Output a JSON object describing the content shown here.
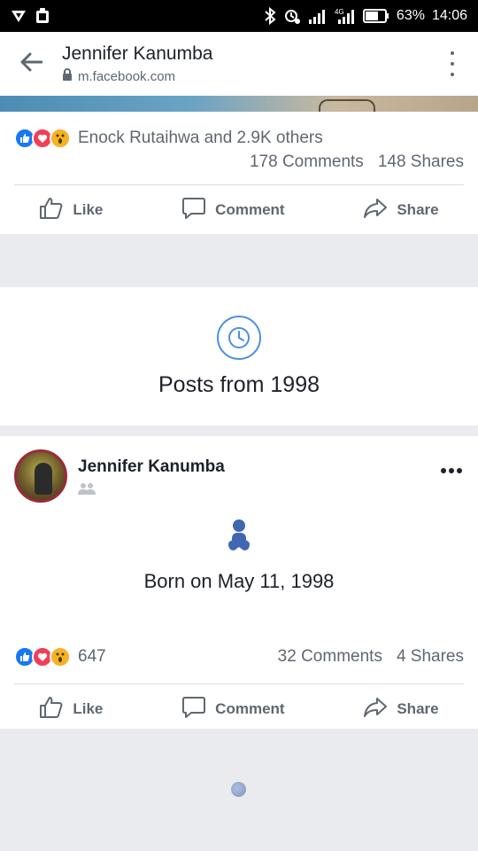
{
  "status_bar": {
    "battery": "63%",
    "time": "14:06",
    "icons": [
      "vpn-icon",
      "notification-icon",
      "bluetooth-icon",
      "alarm-icon",
      "signal-icon",
      "data-icon",
      "battery-icon"
    ]
  },
  "app_bar": {
    "title": "Jennifer Kanumba",
    "url": "m.facebook.com",
    "icons": [
      "back-arrow-icon",
      "lock-icon",
      "more-vertical-icon"
    ]
  },
  "top_post": {
    "reactions_text": "Enock Rutaihwa and 2.9K others",
    "comments": "178 Comments",
    "shares": "148 Shares",
    "actions": {
      "like": "Like",
      "comment": "Comment",
      "share": "Share"
    }
  },
  "memory": {
    "icon": "clock-icon",
    "title": "Posts from 1998"
  },
  "post": {
    "author": "Jennifer Kanumba",
    "audience_icon": "friends-icon",
    "life_event_icon": "baby-icon",
    "life_event": "Born on May 11, 1998",
    "reactions_count": "647",
    "comments": "32 Comments",
    "shares": "4 Shares",
    "actions": {
      "like": "Like",
      "comment": "Comment",
      "share": "Share"
    }
  },
  "colors": {
    "brand_blue": "#1877f2",
    "love_red": "#f33e58",
    "wow_yellow": "#f7b125",
    "clock_blue": "#4a90e2",
    "baby_blue": "#4267b2",
    "muted_text": "#606770"
  }
}
